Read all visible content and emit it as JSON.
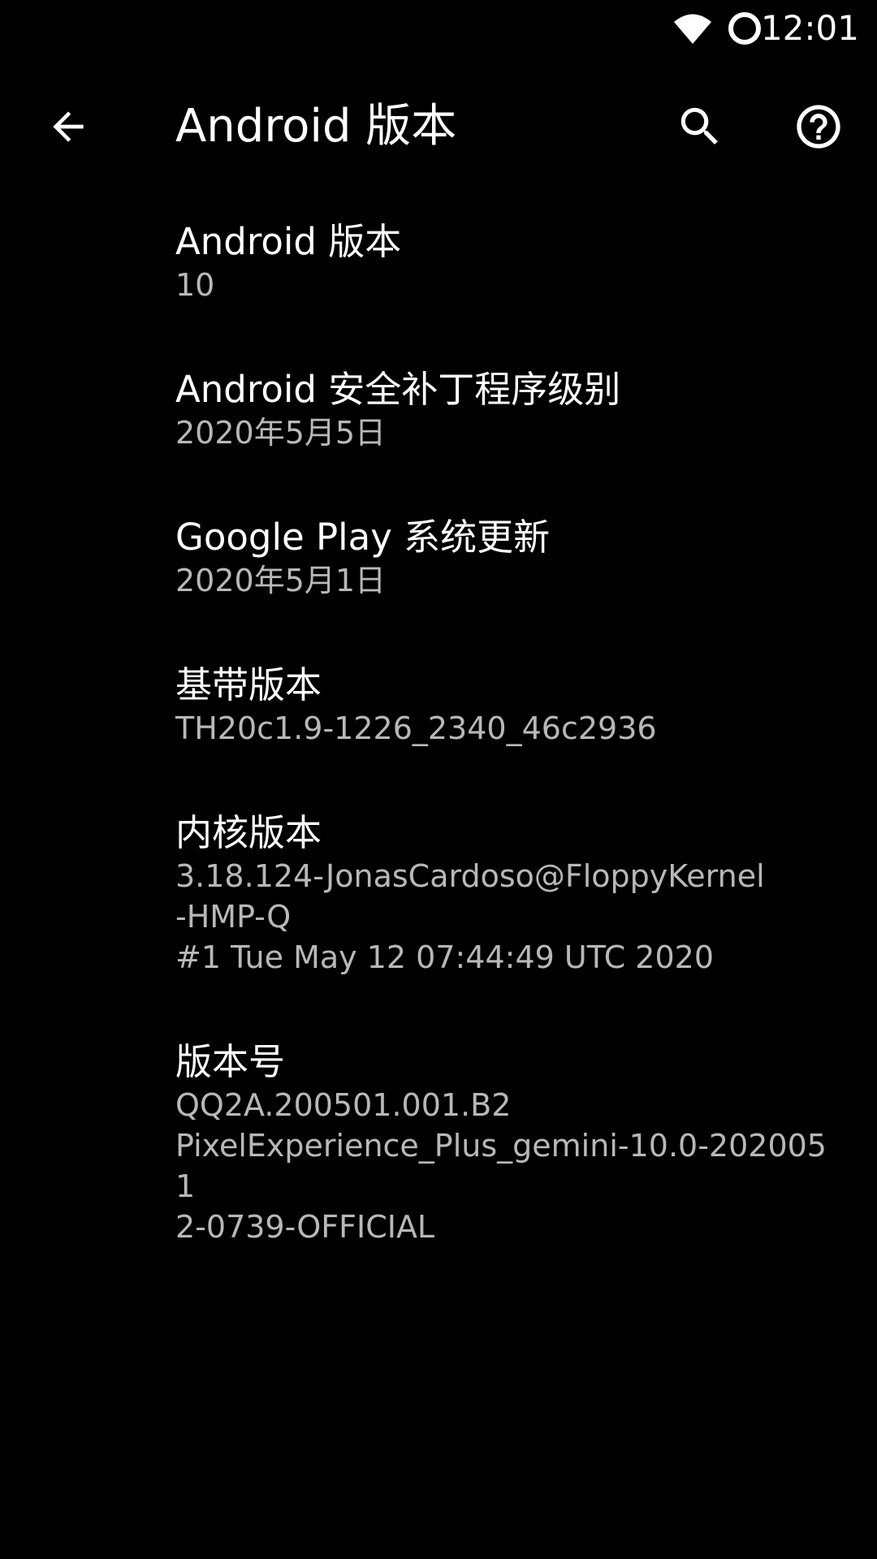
{
  "status_bar": {
    "time": "12:01",
    "icons": [
      "wifi-icon",
      "battery-icon"
    ]
  },
  "toolbar": {
    "title": "Android 版本",
    "back_icon": "arrow-back-icon",
    "search_icon": "search-icon",
    "help_icon": "help-icon"
  },
  "items": [
    {
      "title": "Android 版本",
      "summary": "10"
    },
    {
      "title": "Android 安全补丁程序级别",
      "summary": "2020年5月5日"
    },
    {
      "title": "Google Play 系统更新",
      "summary": "2020年5月1日"
    },
    {
      "title": "基带版本",
      "summary": "TH20c1.9-1226_2340_46c2936"
    },
    {
      "title": "内核版本",
      "summary": "3.18.124-JonasCardoso@FloppyKernel\n-HMP-Q\n#1 Tue May 12 07:44:49 UTC 2020"
    },
    {
      "title": "版本号",
      "summary": "QQ2A.200501.001.B2\nPixelExperience_Plus_gemini-10.0-2020051\n2-0739-OFFICIAL"
    }
  ],
  "colors": {
    "background": "#000000",
    "title_text": "#ffffff",
    "summary_text": "#b8b8b8"
  }
}
